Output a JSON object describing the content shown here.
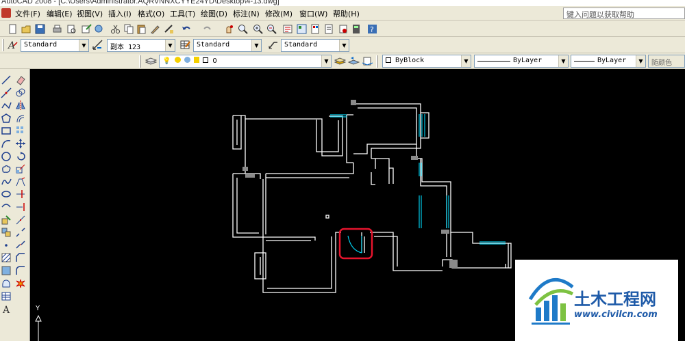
{
  "window": {
    "title": "AutoCAD 2008 - [C:\\Users\\Administrator.AQRVNNXCYYE24YD\\Desktop\\4-13.dwg]"
  },
  "menu": {
    "items": [
      "文件(F)",
      "编辑(E)",
      "视图(V)",
      "插入(I)",
      "格式(O)",
      "工具(T)",
      "绘图(D)",
      "标注(N)",
      "修改(M)",
      "窗口(W)",
      "帮助(H)"
    ]
  },
  "help": {
    "placeholder": "键入问题以获取帮助"
  },
  "styles_toolbar": {
    "text_style": "Standard",
    "dim_style": "副本 123",
    "table_style": "Standard",
    "multileader_style": "Standard"
  },
  "layers_toolbar": {
    "layer": "0",
    "color": "ByBlock",
    "linetype": "ByLayer",
    "lineweight": "ByLayer",
    "plot_style": "随颜色"
  },
  "ucs": {
    "y_label": "Y"
  },
  "watermark": {
    "brand": "土木工程网",
    "url": "www.civilcn.com"
  },
  "colors": {
    "canvas": "#000000",
    "walls": "#ffffff",
    "windows": "#00c8e6",
    "highlight": "#e6142d",
    "toolbar": "#ece9d8"
  },
  "icons": {
    "standard_toolbar": [
      "new-icon",
      "open-icon",
      "save-icon",
      "print-icon",
      "print-preview-icon",
      "publish-icon",
      "3d-publish-icon",
      "cut-icon",
      "copy-icon",
      "paste-icon",
      "match-properties-icon",
      "block-editor-icon",
      "undo-icon",
      "redo-icon",
      "pan-icon",
      "zoom-realtime-icon",
      "zoom-window-icon",
      "zoom-previous-icon",
      "properties-icon",
      "design-center-icon",
      "tool-palettes-icon",
      "sheet-set-icon",
      "markup-icon",
      "quickcalc-icon",
      "help-icon"
    ],
    "draw_toolbar": [
      "line-icon",
      "construction-line-icon",
      "polyline-icon",
      "polygon-icon",
      "rectangle-icon",
      "arc-icon",
      "circle-icon",
      "revision-cloud-icon",
      "spline-icon",
      "ellipse-icon",
      "ellipse-arc-icon",
      "insert-block-icon",
      "make-block-icon",
      "point-icon",
      "hatch-icon",
      "gradient-icon",
      "region-icon",
      "table-icon",
      "multiline-text-icon"
    ],
    "modify_toolbar": [
      "erase-icon",
      "copy-object-icon",
      "mirror-icon",
      "offset-icon",
      "array-icon",
      "move-icon",
      "rotate-icon",
      "scale-icon",
      "stretch-icon",
      "trim-icon",
      "extend-icon",
      "break-at-point-icon",
      "break-icon",
      "join-icon",
      "chamfer-icon",
      "fillet-icon",
      "explode-icon"
    ]
  }
}
